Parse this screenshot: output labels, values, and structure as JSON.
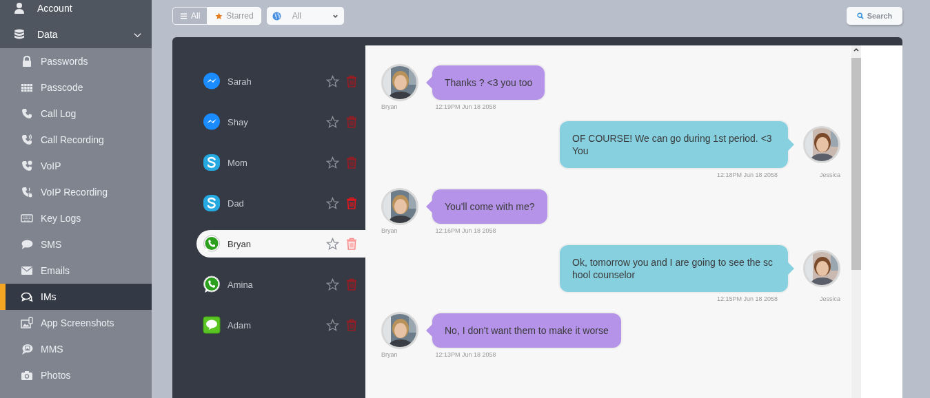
{
  "sidebar": {
    "items": [
      {
        "label": "Account"
      },
      {
        "label": "Data",
        "expanded": true,
        "children": [
          {
            "label": "Passwords",
            "selected": false
          },
          {
            "label": "Passcode",
            "selected": false
          },
          {
            "label": "Call Log",
            "selected": false
          },
          {
            "label": "Call Recording",
            "selected": false
          },
          {
            "label": "VoIP",
            "selected": false
          },
          {
            "label": "VoIP Recording",
            "selected": false
          },
          {
            "label": "Key Logs",
            "selected": false
          },
          {
            "label": "SMS",
            "selected": false
          },
          {
            "label": "Emails",
            "selected": false
          },
          {
            "label": "IMs",
            "selected": true
          },
          {
            "label": "App Screenshots",
            "selected": false
          },
          {
            "label": "MMS",
            "selected": false
          },
          {
            "label": "Photos",
            "selected": false
          }
        ]
      }
    ]
  },
  "filters": [
    {
      "label": "All",
      "selected": true
    },
    {
      "label": "Starred",
      "selected": false
    }
  ],
  "app_filter": {
    "value": "All"
  },
  "search_button": "Search",
  "contacts": [
    {
      "name": "Sarah",
      "kind": "messenger",
      "selected": false,
      "starred": false,
      "hovered": false
    },
    {
      "name": "Shay",
      "kind": "messenger",
      "selected": false,
      "starred": false,
      "hovered": false
    },
    {
      "name": "Mom",
      "kind": "skype",
      "selected": false,
      "starred": false,
      "hovered": false
    },
    {
      "name": "Dad",
      "kind": "skype",
      "selected": false,
      "starred": false,
      "hovered": true
    },
    {
      "name": "Bryan",
      "kind": "whatsapp",
      "selected": true,
      "starred": false,
      "hovered": false
    },
    {
      "name": "Amina",
      "kind": "whatsapp",
      "selected": false,
      "starred": false,
      "hovered": false
    },
    {
      "name": "Adam",
      "kind": "line",
      "selected": false,
      "starred": false,
      "hovered": false
    }
  ],
  "messages": [
    {
      "kind": "received",
      "sender": "Bryan",
      "text": "Thanks ? <3 you too",
      "time": "12:19PM Jun 18 2058"
    },
    {
      "kind": "sent",
      "sender": "Jessica",
      "text": "OF COURSE! We can go during 1st period. <3 You",
      "time": "12:18PM Jun 18 2058"
    },
    {
      "kind": "received",
      "sender": "Bryan",
      "text": "You'll come with me?",
      "time": "12:16PM Jun 18 2058"
    },
    {
      "kind": "sent",
      "sender": "Jessica",
      "text": "Ok, tomorrow you and I are going to see the school counselor",
      "time": "12:15PM Jun 18 2058"
    },
    {
      "kind": "received",
      "sender": "Bryan",
      "text": "No, I don't want them to make it worse",
      "time": "12:13PM Jun 18 2058"
    }
  ]
}
